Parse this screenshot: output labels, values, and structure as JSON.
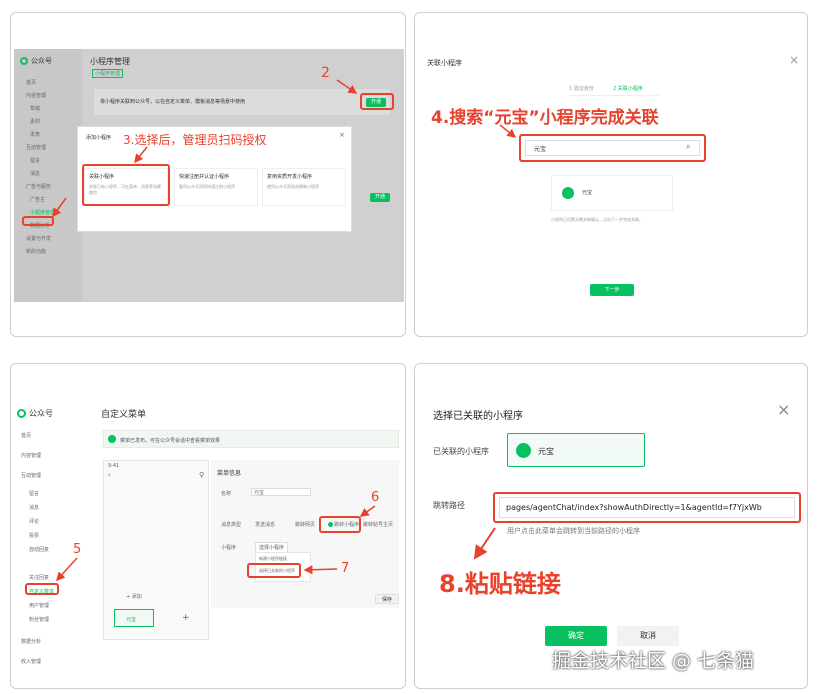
{
  "panel1": {
    "logo": "公众号",
    "page_title": "小程序管理",
    "subtitle": "小程序管理",
    "sidebar": [
      "首页",
      "内容管理",
      "草稿",
      "素材",
      "发表",
      "互动管理",
      "留言",
      "消息",
      "广告与服务",
      "广告主",
      "小程序管理",
      "数据分析",
      "设置与开发",
      "新的功能"
    ],
    "banner_title": "将小程序关联到公众号，以在自定义菜单、模板消息等场景中使用",
    "open_label": "开通",
    "open_label_2": "开通",
    "modal_title": "添加小程序",
    "options": [
      {
        "title": "关联小程序",
        "desc": "关联已有小程序，可在菜单、消息等场景使用"
      },
      {
        "title": "快速注册并认证小程序",
        "desc": "复用公众号资质快速注册小程序"
      },
      {
        "title": "复用资质开发小程序",
        "desc": "使用公众号资质创建新小程序"
      }
    ],
    "annotation_2": "2",
    "annotation_3": "3.选择后，管理员扫码授权"
  },
  "panel2": {
    "title": "关联小程序",
    "steps": [
      "1 验证身份",
      "2 关联小程序"
    ],
    "annotation_4": "4.搜索“元宝”小程序完成关联",
    "search_value": "元宝",
    "result_name": "元宝",
    "note": "小程序已设置无需关联确认，点击下一步完成关联。",
    "next_label": "下一步"
  },
  "panel3": {
    "logo": "公众号",
    "page_title": "自定义菜单",
    "notice": "菜单已发布，可在公众号会话中查看菜单效果",
    "sidebar": [
      "首页",
      "内容管理",
      "互动管理",
      "留言",
      "消息",
      "评论",
      "投票",
      "自动回复",
      "关注回复",
      "自定义菜单",
      "用户管理",
      "粉丝管理",
      "数据分析",
      "收入管理"
    ],
    "phone_time": "9:41",
    "menu_item_label": "+ 添加",
    "menu_name": "元宝",
    "menu_info_title": "菜单信息",
    "name_label": "名称",
    "name_value": "元宝",
    "content_label": "消息类型",
    "types": [
      "发送消息",
      "跳转网页",
      "跳转小程序",
      "跳转帖号主页"
    ],
    "mini_label": "小程序",
    "dropdown_btn": "选择小程序",
    "dropdown_items": [
      "新建小程序链接",
      "选择已关联的小程序"
    ],
    "save_label": "保存",
    "annotation_5": "5",
    "annotation_6": "6",
    "annotation_7": "7"
  },
  "panel4": {
    "title": "选择已关联的小程序",
    "linked_label": "已关联的小程序",
    "linked_name": "元宝",
    "path_label": "跳转路径",
    "path_value": "pages/agentChat/index?showAuthDirectly=1&agentId=f7YjxWb",
    "path_hint": "用户点击此菜单会跳转到当前路径的小程序",
    "annotation_8": "8.粘贴链接",
    "confirm_label": "确定",
    "cancel_label": "取消"
  },
  "watermark": "掘金技术社区 @ 七条猫",
  "colors": {
    "accent": "#07c160",
    "annotation": "#e8412c"
  }
}
